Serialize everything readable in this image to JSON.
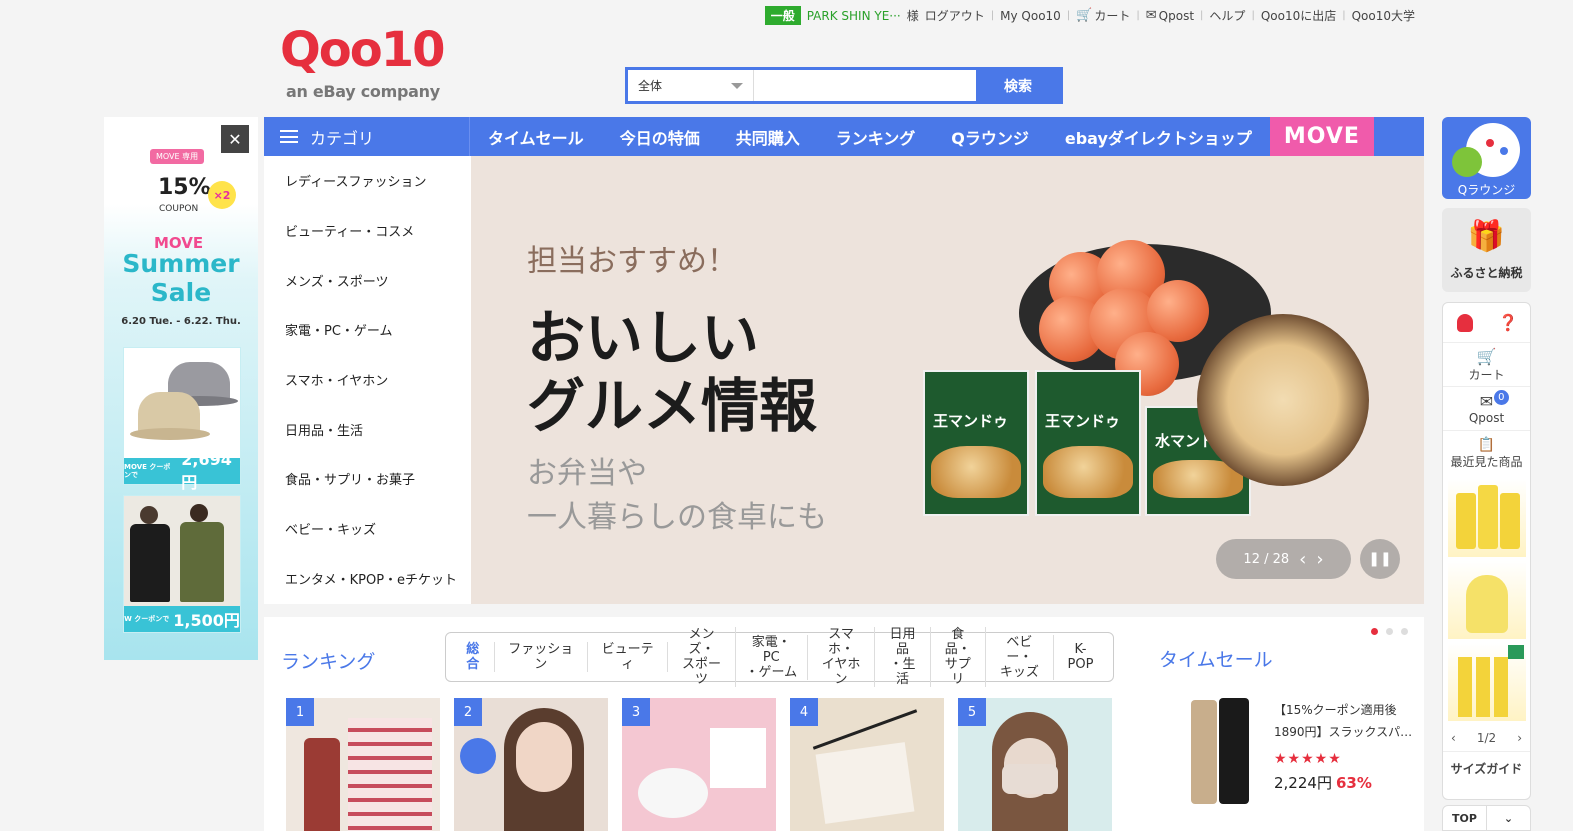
{
  "header": {
    "grade": "一般",
    "username": "PARK SHIN YE···",
    "honorific": "様",
    "links": [
      "ログアウト",
      "My Qoo10",
      "カート",
      "Qpost",
      "ヘルプ",
      "Qoo10に出店",
      "Qoo10大学"
    ],
    "logo_text": "Qoo10",
    "logo_sub": "an eBay company"
  },
  "search": {
    "category": "全体",
    "value": "",
    "button": "検索"
  },
  "left_ad": {
    "tag": "MOVE 専用",
    "percent": "15%",
    "multiplier": "×2",
    "coupon": "COUPON",
    "brand": "MOVE",
    "headline": "Summer Sale",
    "dates": "6.20 Tue. - 6.22. Thu.",
    "items": [
      {
        "badge": "MOVE クーポンで",
        "price": "2,694円"
      },
      {
        "badge": "W クーポンで",
        "price": "1,500円"
      }
    ]
  },
  "nav": {
    "category_label": "カテゴリ",
    "items": [
      "タイムセール",
      "今日の特価",
      "共同購入",
      "ランキング",
      "Qラウンジ",
      "ebayダイレクトショップ"
    ],
    "move": "MOVE"
  },
  "categories": [
    "レディースファッション",
    "ビューティー・コスメ",
    "メンズ・スポーツ",
    "家電・PC・ゲーム",
    "スマホ・イヤホン",
    "日用品・生活",
    "食品・サプリ・お菓子",
    "ベビー・キッズ",
    "エンタメ・KPOP・eチケット"
  ],
  "banner": {
    "sub": "担当おすすめ！",
    "title_line1": "おいしい",
    "title_line2": "グルメ情報",
    "desc_line1": "お弁当や",
    "desc_line2": "一人暮らしの食卓にも",
    "pack_label": "王マンドゥ",
    "pack_label3": "水マンドゥ",
    "pager": "12 / 28"
  },
  "ranking": {
    "title": "ランキング",
    "tabs": [
      "総合",
      "ファッション",
      "ビューティ",
      "メンズ・\nスポーツ",
      "家電・PC\n・ゲーム",
      "スマホ・\nイヤホン",
      "日用品\n・生活",
      "食品・\nサプリ",
      "ベビー・\nキッズ",
      "K-POP"
    ],
    "products": [
      "1",
      "2",
      "3",
      "4",
      "5"
    ]
  },
  "timesale": {
    "title": "タイムセール",
    "item_name": "【15%クーポン適用後1890円】スラックスパ…",
    "stars": "★★★★★",
    "price": "2,224円",
    "discount": "63%"
  },
  "right_sidebar": {
    "qlounge": "Qラウンジ",
    "furusato": "ふるさと納税",
    "cart": "カート",
    "qpost": "Qpost",
    "qpost_count": "0",
    "recent": "最近見た商品",
    "page": "1/2",
    "size_guide": "サイズガイド",
    "top": "TOP"
  },
  "colors": {
    "brand_blue": "#4a78e8",
    "brand_red": "#e62f3e",
    "move_pink": "#f05bab"
  }
}
